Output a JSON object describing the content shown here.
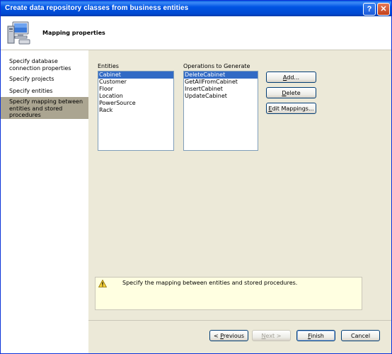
{
  "window": {
    "title": "Create data repository classes from business entities"
  },
  "header": {
    "title": "Mapping properties"
  },
  "steps": [
    {
      "label": "Specify database connection properties"
    },
    {
      "label": "Specify projects"
    },
    {
      "label": "Specify entities"
    },
    {
      "label": "Specify mapping between entities and stored procedures"
    }
  ],
  "entities": {
    "label": "Entities",
    "items": [
      "Cabinet",
      "Customer",
      "Floor",
      "Location",
      "PowerSource",
      "Rack"
    ],
    "selected": "Cabinet"
  },
  "operations": {
    "label": "Operations to Generate",
    "items": [
      "DeleteCabinet",
      "GetAllFromCabinet",
      "InsertCabinet",
      "UpdateCabinet"
    ],
    "selected": "DeleteCabinet"
  },
  "actions": {
    "add": {
      "pre": "",
      "key": "A",
      "post": "dd..."
    },
    "delete": {
      "pre": "",
      "key": "D",
      "post": "elete"
    },
    "edit": {
      "pre": "",
      "key": "E",
      "post": "dit Mappings..."
    }
  },
  "info": {
    "message": "Specify the mapping between entities and stored procedures."
  },
  "footer": {
    "previous": {
      "pre": "< ",
      "key": "P",
      "post": "revious"
    },
    "next": {
      "pre": "",
      "key": "N",
      "post": "ext >"
    },
    "finish": {
      "pre": "",
      "key": "F",
      "post": "inish"
    },
    "cancel": "Cancel"
  }
}
